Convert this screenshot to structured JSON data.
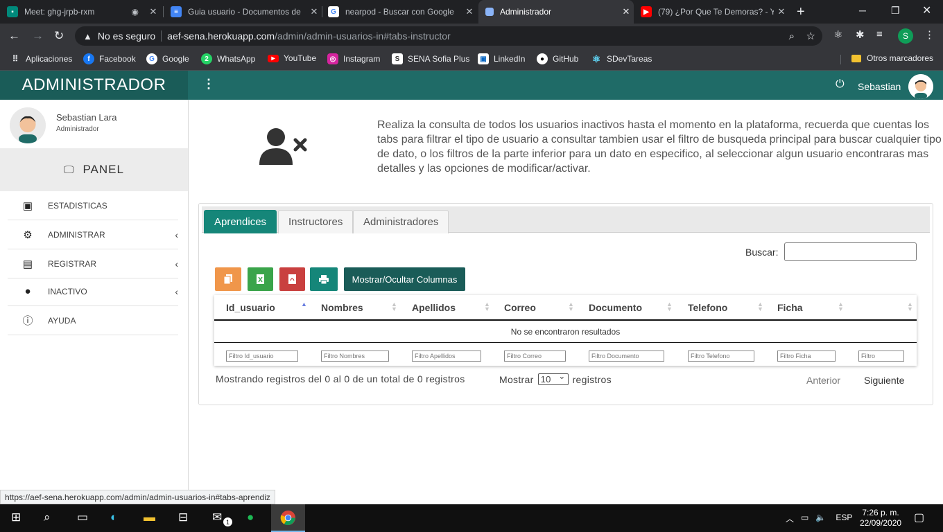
{
  "browser": {
    "tabs": [
      {
        "title": "Meet: ghg-jrpb-rxm",
        "favicon": "meet-icon",
        "color": "#00897b"
      },
      {
        "title": "Guia usuario - Documentos de",
        "favicon": "docs-icon",
        "color": "#4285f4"
      },
      {
        "title": "nearpod - Buscar con Google",
        "favicon": "google-icon",
        "color": "#ffffff"
      },
      {
        "title": "Administrador",
        "favicon": "page-icon",
        "color": "#8ab4f8"
      },
      {
        "title": "(79) ¿Por Que Te Demoras? - Y",
        "favicon": "youtube-icon",
        "color": "#ff0000"
      }
    ],
    "insecure_label": "No es seguro",
    "url_host": "aef-sena.herokuapp.com",
    "url_path": "/admin/admin-usuarios-in#tabs-instructor",
    "profile_initial": "S",
    "bookmarks": [
      {
        "label": "Aplicaciones"
      },
      {
        "label": "Facebook"
      },
      {
        "label": "Google"
      },
      {
        "label": "WhatsApp"
      },
      {
        "label": "YouTube"
      },
      {
        "label": "Instagram"
      },
      {
        "label": "SENA Sofia Plus"
      },
      {
        "label": "LinkedIn"
      },
      {
        "label": "GitHub"
      },
      {
        "label": "SDevTareas"
      }
    ],
    "other_bookmarks": "Otros marcadores",
    "status_url": "https://aef-sena.herokuapp.com/admin/admin-usuarios-in#tabs-aprendiz"
  },
  "header": {
    "brand": "ADMINISTRADOR",
    "user_name": "Sebastian"
  },
  "sidebar": {
    "user_name": "Sebastian Lara",
    "user_role": "Administrador",
    "panel_label": "PANEL",
    "items": [
      {
        "label": "ESTADISTICAS",
        "icon": "chart-book-icon"
      },
      {
        "label": "ADMINISTRAR",
        "icon": "users-gear-icon"
      },
      {
        "label": "REGISTRAR",
        "icon": "id-card-icon"
      },
      {
        "label": "INACTIVO",
        "icon": "user-clock-icon"
      },
      {
        "label": "AYUDA",
        "icon": "info-icon"
      }
    ]
  },
  "main": {
    "description": "Realiza la consulta de todos los usuarios inactivos hasta el momento en la plataforma, recuerda que cuentas los tabs para filtrar el tipo de usuario a consultar tambien usar el filtro de busqueda principal para buscar cualquier tipo de dato, o los filtros de la parte inferior para un dato en especifico, al seleccionar algun usuario encontraras mas detalles y las opciones de modificar/activar.",
    "tabs": [
      {
        "label": "Aprendices",
        "active": true
      },
      {
        "label": "Instructores",
        "active": false
      },
      {
        "label": "Administradores",
        "active": false
      }
    ],
    "search_label": "Buscar:",
    "search_value": "",
    "toggle_columns_label": "Mostrar/Ocultar Columnas",
    "columns": [
      "Id_usuario",
      "Nombres",
      "Apellidos",
      "Correo",
      "Documento",
      "Telefono",
      "Ficha",
      ""
    ],
    "empty_message": "No se encontraron resultados",
    "filters": [
      "Filtro Id_usuario",
      "Filtro Nombres",
      "Filtro Apellidos",
      "Filtro Correo",
      "Filtro Documento",
      "Filtro Telefono",
      "Filtro Ficha",
      "Filtro"
    ],
    "info": "Mostrando registros del 0 al 0 de un total de 0 registros",
    "show_label": "Mostrar",
    "page_size": "10",
    "records_label": "registros",
    "prev_label": "Anterior",
    "next_label": "Siguiente",
    "colors": {
      "teal": "#158679",
      "dark_teal": "#1a5c58",
      "copy": "#f0964a",
      "excel": "#3aa44a",
      "pdf": "#c9403f"
    }
  },
  "taskbar": {
    "language": "ESP",
    "time": "7:26 p. m.",
    "date": "22/09/2020",
    "mail_badge": "1"
  }
}
